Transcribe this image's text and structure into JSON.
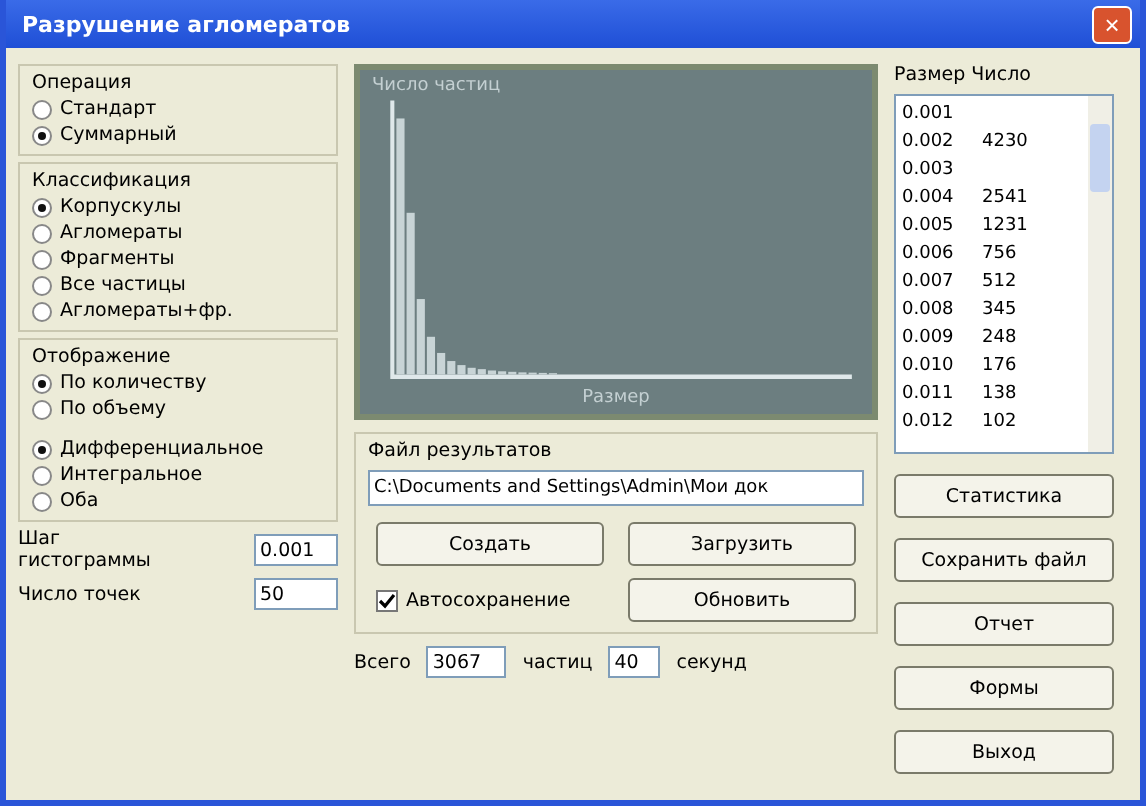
{
  "window": {
    "title": "Разрушение агломератов",
    "close": "×"
  },
  "groups": [
    {
      "title": "Операция",
      "options": [
        {
          "label": "Стандарт",
          "selected": false
        },
        {
          "label": "Суммарный",
          "selected": true
        }
      ]
    },
    {
      "title": "Классификация",
      "options": [
        {
          "label": "Корпускулы",
          "selected": true
        },
        {
          "label": "Агломераты",
          "selected": false
        },
        {
          "label": "Фрагменты",
          "selected": false
        },
        {
          "label": "Все частицы",
          "selected": false
        },
        {
          "label": "Агломераты+фр.",
          "selected": false
        }
      ]
    },
    {
      "title": "Отображение",
      "options": [
        {
          "label": "По количеству",
          "selected": true
        },
        {
          "label": "По объему",
          "selected": false
        }
      ],
      "options2": [
        {
          "label": "Дифференциальное",
          "selected": true
        },
        {
          "label": "Интегральное",
          "selected": false
        },
        {
          "label": "Оба",
          "selected": false
        }
      ]
    }
  ],
  "step": {
    "label": "Шаг гистограммы",
    "value": "0.001"
  },
  "points": {
    "label": "Число точек",
    "value": "50"
  },
  "chart": {
    "title": "Число частиц",
    "xlabel": "Размер"
  },
  "file": {
    "label": "Файл результатов",
    "value": "C:\\Documents and Settings\\Admin\\Мои док"
  },
  "buttons": [
    "Создать",
    "Загрузить",
    "Обновить"
  ],
  "autosave": {
    "label": "Автосохранение",
    "checked": true
  },
  "totals": {
    "label": "Всего",
    "value": "3067",
    "unit": "частиц",
    "time": "40",
    "time_unit": "секунд"
  },
  "list": {
    "title": "Размер Число",
    "rows": [
      [
        "0.001",
        ""
      ],
      [
        "0.002",
        "4230"
      ],
      [
        "0.003",
        ""
      ],
      [
        "0.004",
        "2541"
      ],
      [
        "0.005",
        "1231"
      ],
      [
        "0.006",
        "756"
      ],
      [
        "0.007",
        "512"
      ],
      [
        "0.008",
        "345"
      ],
      [
        "0.009",
        "248"
      ],
      [
        "0.010",
        "176"
      ],
      [
        "0.011",
        "138"
      ],
      [
        "0.012",
        "102"
      ]
    ]
  },
  "side_buttons": [
    "Статистика",
    "Сохранить файл",
    "Отчет",
    "Формы"
  ],
  "exit": "Выход"
}
